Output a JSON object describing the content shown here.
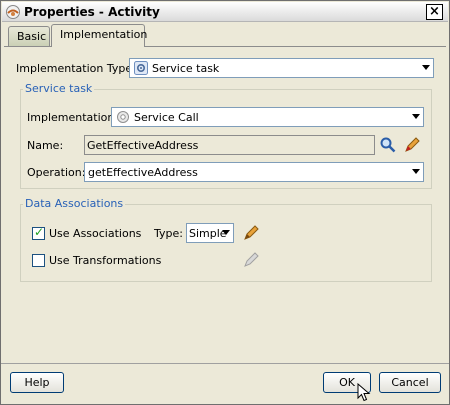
{
  "window": {
    "title": "Properties - Activity"
  },
  "tabs": [
    {
      "label": "Basic",
      "selected": false
    },
    {
      "label": "Implementation",
      "selected": true
    }
  ],
  "implementation_type": {
    "label": "Implementation Type:",
    "value": "Service task",
    "icon": "gear-icon"
  },
  "service_task": {
    "title": "Service task",
    "implementation": {
      "label": "Implementation:",
      "value": "Service Call",
      "icon": "gear-icon"
    },
    "name": {
      "label": "Name:",
      "value": "GetEffectiveAddress"
    },
    "operation": {
      "label": "Operation:",
      "value": "getEffectiveAddress"
    }
  },
  "data_associations": {
    "title": "Data Associations",
    "use_associations": {
      "label": "Use Associations",
      "checked": true
    },
    "type": {
      "label": "Type:",
      "value": "Simple"
    },
    "use_transformations": {
      "label": "Use Transformations",
      "checked": false
    }
  },
  "buttons": {
    "help": "Help",
    "ok": "OK",
    "cancel": "Cancel"
  },
  "colors": {
    "group_title": "#2861b7",
    "dialog_bg": "#ece9d8",
    "field_border": "#7f9db9"
  }
}
